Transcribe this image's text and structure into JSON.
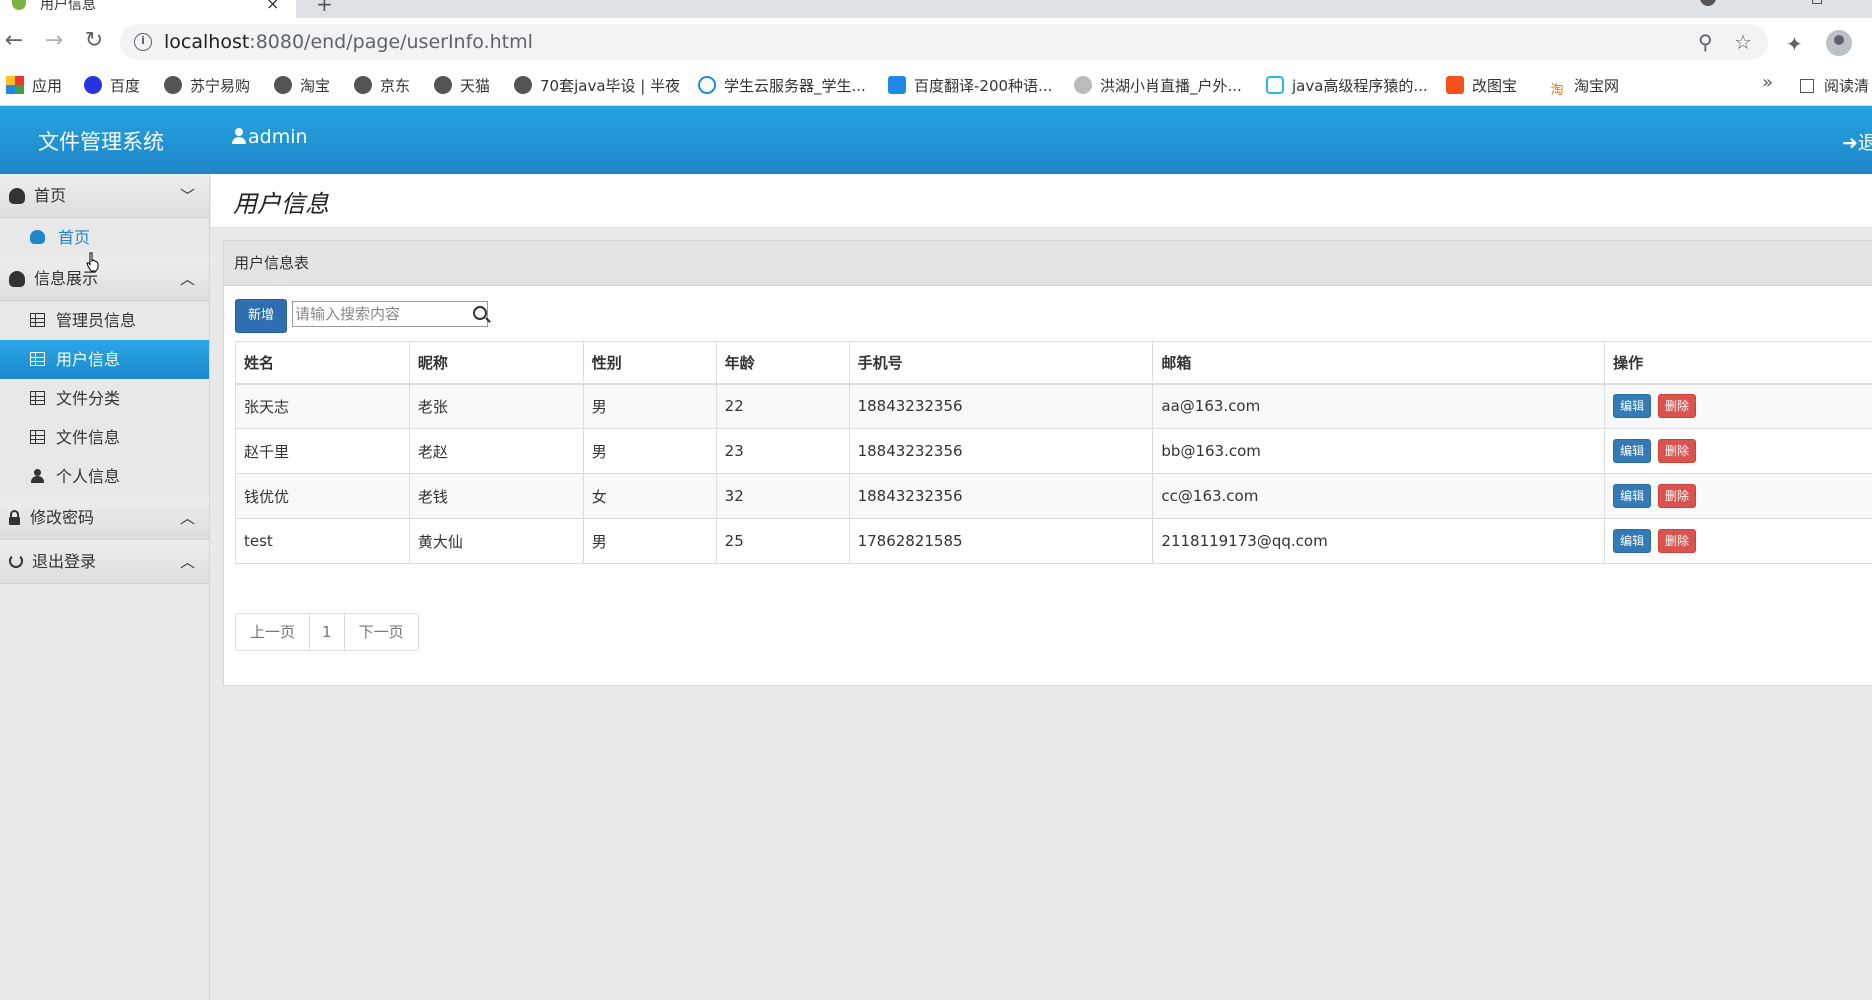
{
  "browser": {
    "tab_title": "用户信息",
    "url_host": "localhost",
    "url_path": ":8080/end/page/userInfo.html",
    "bookmarks": [
      {
        "label": "应用",
        "color": "#e53935"
      },
      {
        "label": "百度",
        "color": "#2932e1"
      },
      {
        "label": "苏宁易购",
        "color": "#555555"
      },
      {
        "label": "淘宝",
        "color": "#555555"
      },
      {
        "label": "京东",
        "color": "#555555"
      },
      {
        "label": "天猫",
        "color": "#555555"
      },
      {
        "label": "70套java毕设 | 半夜",
        "color": "#555555"
      },
      {
        "label": "学生云服务器_学生...",
        "color": "#1e88e5"
      },
      {
        "label": "百度翻译-200种语...",
        "color": "#1e88e5"
      },
      {
        "label": "洪湖小肖直播_户外...",
        "color": "#888888"
      },
      {
        "label": "java高级程序猿的...",
        "color": "#29b6f6"
      },
      {
        "label": "改图宝",
        "color": "#f4511e"
      },
      {
        "label": "淘宝网",
        "color": "#ff6f00"
      }
    ],
    "bookmarks_more": "»",
    "reading_list": "阅读清"
  },
  "header": {
    "brand": "文件管理系统",
    "user": "admin",
    "logout": "退"
  },
  "sidebar": {
    "groups": [
      {
        "label": "首页",
        "chevron": "down",
        "items": [
          {
            "label": "首页",
            "icon": "dashboard-icon"
          }
        ]
      },
      {
        "label": "信息展示",
        "chevron": "up",
        "items": [
          {
            "label": "管理员信息",
            "icon": "table-icon"
          },
          {
            "label": "用户信息",
            "icon": "table-icon",
            "active": true
          },
          {
            "label": "文件分类",
            "icon": "table-icon"
          },
          {
            "label": "文件信息",
            "icon": "table-icon"
          },
          {
            "label": "个人信息",
            "icon": "user-icon"
          }
        ]
      },
      {
        "label": "修改密码",
        "chevron": "up",
        "icon": "lock-icon"
      },
      {
        "label": "退出登录",
        "chevron": "up",
        "icon": "power-icon"
      }
    ]
  },
  "page": {
    "title": "用户信息",
    "panel_heading": "用户信息表",
    "add_button": "新增",
    "search_placeholder": "请输入搜索内容"
  },
  "table": {
    "columns": [
      "姓名",
      "昵称",
      "性别",
      "年龄",
      "手机号",
      "邮箱",
      "操作"
    ],
    "rows": [
      [
        "张天志",
        "老张",
        "男",
        "22",
        "18843232356",
        "aa@163.com"
      ],
      [
        "赵千里",
        "老赵",
        "男",
        "23",
        "18843232356",
        "bb@163.com"
      ],
      [
        "钱优优",
        "老钱",
        "女",
        "32",
        "18843232356",
        "cc@163.com"
      ],
      [
        "test",
        "黄大仙",
        "男",
        "25",
        "17862821585",
        "2118119173@qq.com"
      ]
    ],
    "edit_label": "编辑",
    "delete_label": "删除"
  },
  "pagination": {
    "prev": "上一页",
    "current": "1",
    "next": "下一页"
  }
}
